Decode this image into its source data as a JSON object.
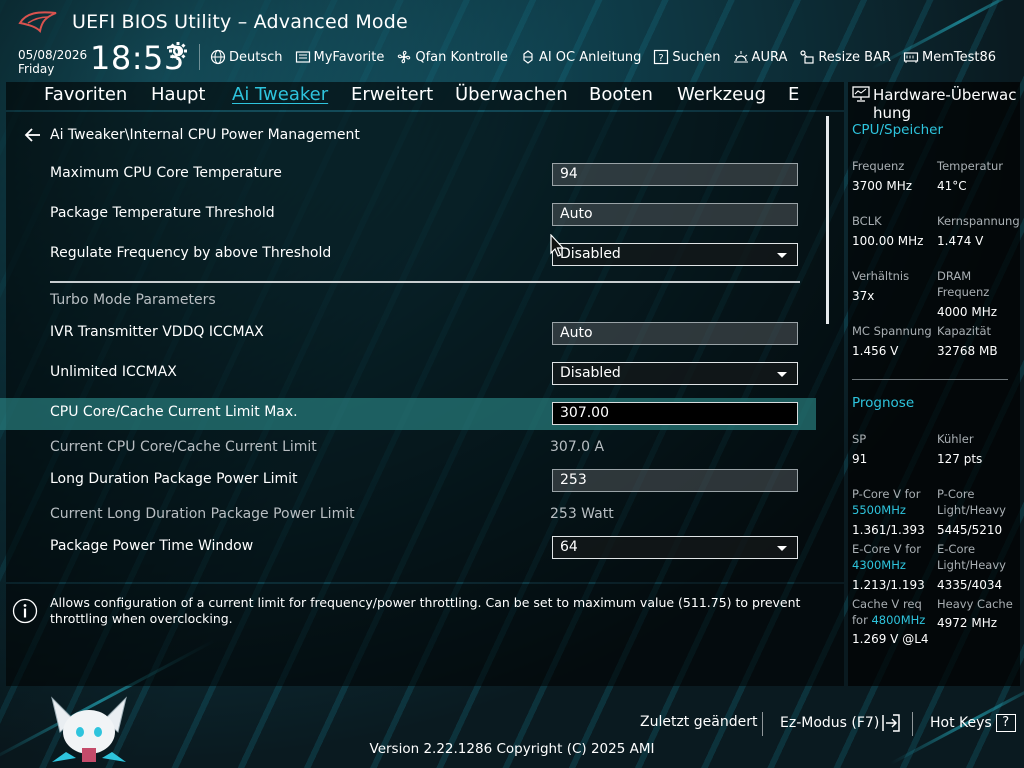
{
  "header": {
    "title": "UEFI BIOS Utility – Advanced Mode",
    "date": "05/08/2026",
    "day": "Friday",
    "time": "18:53",
    "toolbar": [
      {
        "label": "Deutsch",
        "icon": "globe-icon"
      },
      {
        "label": "MyFavorite",
        "icon": "favorite-icon"
      },
      {
        "label": "Qfan Kontrolle",
        "icon": "fan-icon"
      },
      {
        "label": "AI OC Anleitung",
        "icon": "ai-oc-icon"
      },
      {
        "label": "Suchen",
        "icon": "help-search-icon"
      },
      {
        "label": "AURA",
        "icon": "aura-icon"
      },
      {
        "label": "Resize BAR",
        "icon": "resize-bar-icon"
      },
      {
        "label": "MemTest86",
        "icon": "memtest-icon"
      }
    ]
  },
  "tabs": [
    {
      "label": "Favoriten"
    },
    {
      "label": "Haupt"
    },
    {
      "label": "Ai Tweaker",
      "active": true
    },
    {
      "label": "Erweitert"
    },
    {
      "label": "Überwachen"
    },
    {
      "label": "Booten"
    },
    {
      "label": "Werkzeug"
    },
    {
      "label": "E"
    }
  ],
  "main": {
    "breadcrumb": "Ai Tweaker\\Internal CPU Power Management",
    "rows": [
      {
        "label": "Maximum CPU Core Temperature",
        "value": "94",
        "type": "text"
      },
      {
        "label": "Package Temperature Threshold",
        "value": "Auto",
        "type": "text"
      },
      {
        "label": "Regulate Frequency by above Threshold",
        "value": "Disabled",
        "type": "dropdown"
      },
      {
        "label": "Turbo Mode Parameters",
        "type": "section"
      },
      {
        "label": "IVR Transmitter VDDQ ICCMAX",
        "value": "Auto",
        "type": "text"
      },
      {
        "label": "Unlimited ICCMAX",
        "value": "Disabled",
        "type": "dropdown"
      },
      {
        "label": "CPU Core/Cache Current Limit Max.",
        "value": "307.00",
        "type": "editing"
      },
      {
        "label": "Current CPU Core/Cache Current Limit",
        "value": "307.0 A",
        "type": "static"
      },
      {
        "label": "Long Duration Package Power Limit",
        "value": "253",
        "type": "text"
      },
      {
        "label": "Current Long Duration Package Power Limit",
        "value": "253 Watt",
        "type": "static"
      },
      {
        "label": "Package Power Time Window",
        "value": "64",
        "type": "dropdown"
      }
    ]
  },
  "help": {
    "text": "Allows configuration of a current limit for frequency/power throttling. Can be set to maximum value (511.75) to prevent throttling when overclocking."
  },
  "hardware": {
    "title_line1": "Hardware-Überwac",
    "title_line2": "hung",
    "cpu_section": "CPU/Speicher",
    "cpu": [
      {
        "label": "Frequenz",
        "value": "3700 MHz"
      },
      {
        "label": "Temperatur",
        "value": "41°C"
      },
      {
        "label": "BCLK",
        "value": "100.00 MHz"
      },
      {
        "label": "Kernspannung",
        "value": "1.474 V"
      },
      {
        "label": "Verhältnis",
        "value": "37x"
      },
      {
        "label": "DRAM Frequenz",
        "value": "4000 MHz"
      },
      {
        "label": "MC Spannung",
        "value": "1.456 V"
      },
      {
        "label": "Kapazität",
        "value": "32768 MB"
      }
    ],
    "prognose_section": "Prognose",
    "prognose": {
      "sp_label": "SP",
      "sp_value": "91",
      "cooler_label": "Kühler",
      "cooler_value": "127 pts",
      "pcore_label": "P-Core V for",
      "pcore_freq": "5500MHz",
      "pcore_value": "1.361/1.393",
      "pcore_lh_label_1": "P-Core",
      "pcore_lh_label_2": "Light/Heavy",
      "pcore_lh_value": "5445/5210",
      "ecore_label": "E-Core V for",
      "ecore_freq": "4300MHz",
      "ecore_value": "1.213/1.193",
      "ecore_lh_label_1": "E-Core",
      "ecore_lh_label_2": "Light/Heavy",
      "ecore_lh_value": "4335/4034",
      "cache_label_1": "Cache V req",
      "cache_label_2": "for",
      "cache_freq": "4800MHz",
      "cache_value": "1.269 V @L4",
      "heavy_cache_label": "Heavy Cache",
      "heavy_cache_value": "4972 MHz"
    }
  },
  "footer": {
    "last_changed": "Zuletzt geändert",
    "ez_mode": "Ez-Modus (F7)",
    "hot_keys": "Hot Keys",
    "hot_keys_symbol": "?",
    "version": "Version 2.22.1286 Copyright (C) 2025 AMI"
  },
  "colors": {
    "accent": "#2ec4dd",
    "highlight_row": "#287d7d",
    "panel": "#000000"
  }
}
